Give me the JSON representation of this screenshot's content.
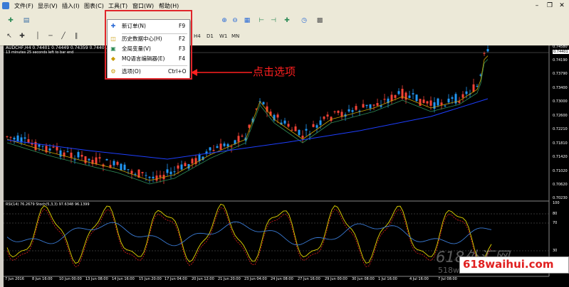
{
  "menubar": {
    "items": [
      "文件(F)",
      "显示(V)",
      "插入(I)",
      "图表(C)",
      "工具(T)",
      "窗口(W)",
      "帮助(H)"
    ]
  },
  "toolbar": {
    "timeframes": [
      "H4",
      "D1",
      "W1",
      "MN"
    ]
  },
  "chart": {
    "title": "AUDCHF,H4  0.74401 0.74449 0.74359 0.74401",
    "subtitle": "13 minutes 25 seconds left to bar end",
    "indicator_label": "RSI(14) 76.2679  Stoch(5,3,3) 97.6348 96.1399",
    "current_price": "0.74401"
  },
  "chart_data": {
    "type": "line",
    "title": "AUDCHF,H4",
    "price_ticks": [
      "0.74580",
      "0.74190",
      "0.73790",
      "0.73400",
      "0.73000",
      "0.72600",
      "0.72210",
      "0.71810",
      "0.71420",
      "0.71020",
      "0.70620",
      "0.70230"
    ],
    "indicator_ticks": [
      "100",
      "80",
      "70",
      "30",
      "20",
      "0"
    ],
    "x_ticks": [
      "7 Jun 2016",
      "8 Jun 16:00",
      "10 Jun 00:00",
      "13 Jun 08:00",
      "14 Jun 16:00",
      "15 Jun 20:00",
      "17 Jun 04:00",
      "20 Jun 12:00",
      "21 Jun 20:00",
      "23 Jun 04:00",
      "24 Jun 08:00",
      "27 Jun 16:00",
      "29 Jun 00:00",
      "30 Jun 08:00",
      "1 Jul 16:00",
      "4 Jul 16:00",
      "7 Jul 08:00"
    ],
    "ylim": [
      0.7023,
      0.7458
    ]
  },
  "tools_menu": {
    "items": [
      {
        "label": "新订单(N)",
        "shortcut": "F9"
      },
      {
        "label": "历史数据中心(H)",
        "shortcut": "F2"
      },
      {
        "label": "全局变量(V)",
        "shortcut": "F3"
      },
      {
        "label": "MQ语言编辑器(E)",
        "shortcut": "F4"
      },
      {
        "label": "选项(O)",
        "shortcut": "Ctrl+O"
      }
    ]
  },
  "annotation": {
    "text": "点击选项"
  },
  "watermark": {
    "main": "618外汇网",
    "sub": "518wa",
    "url": "618waihui.com"
  },
  "colors": {
    "bull": "#2196f3",
    "bear": "#f44336",
    "ma_blue": "#1e3fff",
    "annotation": "#ff1f1f"
  }
}
